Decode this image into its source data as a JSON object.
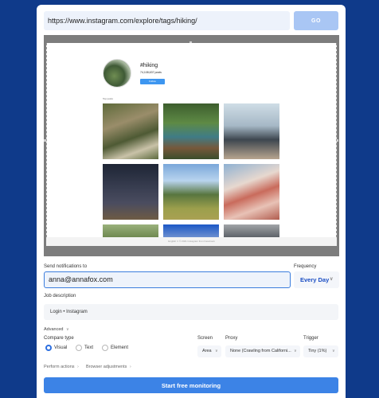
{
  "url_bar": {
    "value": "https://www.instagram.com/explore/tags/hiking/",
    "go_label": "GO"
  },
  "preview": {
    "hashtag": "#hiking",
    "posts": "74,108,637 posts",
    "follow_label": "Follow",
    "top_posts_label": "Top posts",
    "footer_text": "English ∨  © 2021 Instagram from Facebook"
  },
  "notifications": {
    "label": "Send notifications to",
    "email": "anna@annafox.com"
  },
  "frequency": {
    "label": "Frequency",
    "value": "Every Day"
  },
  "job": {
    "label": "Job description",
    "value": "Login • Instagram"
  },
  "advanced_label": "Advanced",
  "compare": {
    "label": "Compare type",
    "options": [
      "Visual",
      "Text",
      "Element"
    ],
    "selected": "Visual"
  },
  "screen": {
    "label": "Screen",
    "value": "Area"
  },
  "proxy": {
    "label": "Proxy",
    "value": "None (Crawling from Californi..."
  },
  "trigger": {
    "label": "Trigger",
    "value": "Tiny (1%)"
  },
  "perform_actions_label": "Perform actions",
  "browser_adjustments_label": "Browser adjustments",
  "submit_label": "Start free monitoring",
  "colors": {
    "background": "#0f3a8a",
    "accent": "#3c83e6",
    "go_button": "#a9c6f4"
  }
}
